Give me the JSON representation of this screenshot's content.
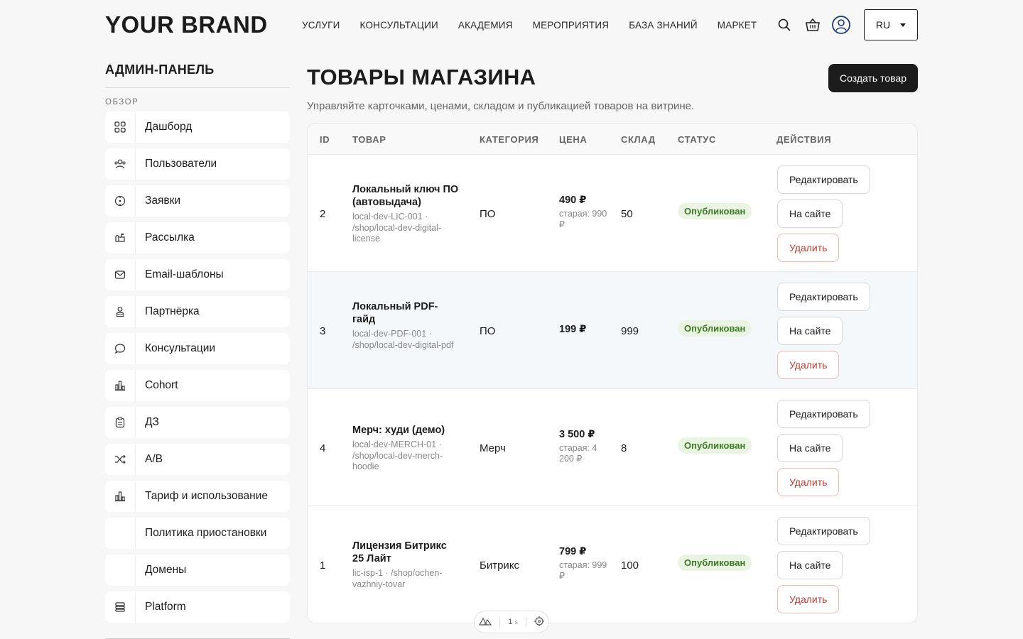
{
  "header": {
    "brand": "YOUR BRAND",
    "nav": [
      "УСЛУГИ",
      "КОНСУЛЬТАЦИИ",
      "АКАДЕМИЯ",
      "МЕРОПРИЯТИЯ",
      "БАЗА ЗНАНИЙ",
      "МАРКЕТ"
    ],
    "lang": "RU",
    "icons": [
      "search-icon",
      "basket-icon",
      "user-icon"
    ]
  },
  "sidebar": {
    "title": "АДМИН-ПАНЕЛЬ",
    "section": "ОБЗОР",
    "items": [
      {
        "label": "Дашборд",
        "icon": "grid-icon"
      },
      {
        "label": "Пользователи",
        "icon": "users-icon"
      },
      {
        "label": "Заявки",
        "icon": "target-icon"
      },
      {
        "label": "Рассылка",
        "icon": "mailbox-icon"
      },
      {
        "label": "Email-шаблоны",
        "icon": "envelope-icon"
      },
      {
        "label": "Партнёрка",
        "icon": "partner-icon"
      },
      {
        "label": "Консультации",
        "icon": "chat-icon"
      },
      {
        "label": "Cohort",
        "icon": "bar-chart-icon"
      },
      {
        "label": "ДЗ",
        "icon": "clipboard-icon"
      },
      {
        "label": "A/B",
        "icon": "shuffle-icon"
      },
      {
        "label": "Тариф и использование",
        "icon": "bar-chart-icon"
      },
      {
        "label": "Политика приостановки",
        "icon": ""
      },
      {
        "label": "Домены",
        "icon": ""
      },
      {
        "label": "Platform",
        "icon": "server-icon"
      }
    ]
  },
  "main": {
    "title": "ТОВАРЫ МАГАЗИНА",
    "subtitle": "Управляйте карточками, ценами, складом и публикацией товаров на витрине.",
    "create_button": "Создать товар",
    "columns": [
      "ID",
      "ТОВАР",
      "КАТЕГОРИЯ",
      "ЦЕНА",
      "СКЛАД",
      "СТАТУС",
      "ДЕЙСТВИЯ"
    ],
    "actions": {
      "edit": "Редактировать",
      "view": "На сайте",
      "delete": "Удалить"
    },
    "rows": [
      {
        "id": "2",
        "name": "Локальный ключ ПО (автовыдача)",
        "meta": "local-dev-LIC-001 · /shop/local-dev-digital-license",
        "category": "ПО",
        "price": "490 ₽",
        "old_price": "старая: 990 ₽",
        "stock": "50",
        "status": "Опубликован"
      },
      {
        "id": "3",
        "name": "Локальный PDF-гайд",
        "meta": "local-dev-PDF-001 · /shop/local-dev-digital-pdf",
        "category": "ПО",
        "price": "199 ₽",
        "old_price": "",
        "stock": "999",
        "status": "Опубликован"
      },
      {
        "id": "4",
        "name": "Мерч: худи (демо)",
        "meta": "local-dev-MERCH-01 · /shop/local-dev-merch-hoodie",
        "category": "Мерч",
        "price": "3 500 ₽",
        "old_price": "старая: 4 200 ₽",
        "stock": "8",
        "status": "Опубликован"
      },
      {
        "id": "1",
        "name": "Лицензия Битрикс 25 Лайт",
        "meta": "lic-isp-1 · /shop/ochen-vazhniy-tovar",
        "category": "Битрикс",
        "price": "799 ₽",
        "old_price": "старая: 999 ₽",
        "stock": "100",
        "status": "Опубликован"
      }
    ]
  },
  "devtools_pill": {
    "label": "1",
    "unit": "s"
  }
}
